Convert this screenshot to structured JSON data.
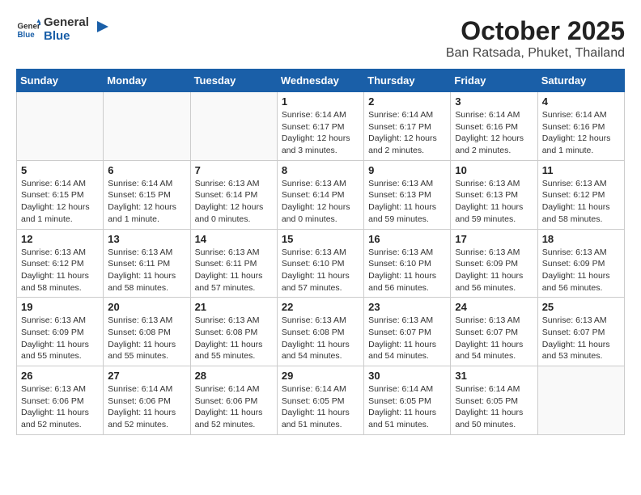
{
  "logo": {
    "text_general": "General",
    "text_blue": "Blue"
  },
  "header": {
    "month": "October 2025",
    "location": "Ban Ratsada, Phuket, Thailand"
  },
  "weekdays": [
    "Sunday",
    "Monday",
    "Tuesday",
    "Wednesday",
    "Thursday",
    "Friday",
    "Saturday"
  ],
  "weeks": [
    [
      {
        "day": "",
        "info": ""
      },
      {
        "day": "",
        "info": ""
      },
      {
        "day": "",
        "info": ""
      },
      {
        "day": "1",
        "info": "Sunrise: 6:14 AM\nSunset: 6:17 PM\nDaylight: 12 hours and 3 minutes."
      },
      {
        "day": "2",
        "info": "Sunrise: 6:14 AM\nSunset: 6:17 PM\nDaylight: 12 hours and 2 minutes."
      },
      {
        "day": "3",
        "info": "Sunrise: 6:14 AM\nSunset: 6:16 PM\nDaylight: 12 hours and 2 minutes."
      },
      {
        "day": "4",
        "info": "Sunrise: 6:14 AM\nSunset: 6:16 PM\nDaylight: 12 hours and 1 minute."
      }
    ],
    [
      {
        "day": "5",
        "info": "Sunrise: 6:14 AM\nSunset: 6:15 PM\nDaylight: 12 hours and 1 minute."
      },
      {
        "day": "6",
        "info": "Sunrise: 6:14 AM\nSunset: 6:15 PM\nDaylight: 12 hours and 1 minute."
      },
      {
        "day": "7",
        "info": "Sunrise: 6:13 AM\nSunset: 6:14 PM\nDaylight: 12 hours and 0 minutes."
      },
      {
        "day": "8",
        "info": "Sunrise: 6:13 AM\nSunset: 6:14 PM\nDaylight: 12 hours and 0 minutes."
      },
      {
        "day": "9",
        "info": "Sunrise: 6:13 AM\nSunset: 6:13 PM\nDaylight: 11 hours and 59 minutes."
      },
      {
        "day": "10",
        "info": "Sunrise: 6:13 AM\nSunset: 6:13 PM\nDaylight: 11 hours and 59 minutes."
      },
      {
        "day": "11",
        "info": "Sunrise: 6:13 AM\nSunset: 6:12 PM\nDaylight: 11 hours and 58 minutes."
      }
    ],
    [
      {
        "day": "12",
        "info": "Sunrise: 6:13 AM\nSunset: 6:12 PM\nDaylight: 11 hours and 58 minutes."
      },
      {
        "day": "13",
        "info": "Sunrise: 6:13 AM\nSunset: 6:11 PM\nDaylight: 11 hours and 58 minutes."
      },
      {
        "day": "14",
        "info": "Sunrise: 6:13 AM\nSunset: 6:11 PM\nDaylight: 11 hours and 57 minutes."
      },
      {
        "day": "15",
        "info": "Sunrise: 6:13 AM\nSunset: 6:10 PM\nDaylight: 11 hours and 57 minutes."
      },
      {
        "day": "16",
        "info": "Sunrise: 6:13 AM\nSunset: 6:10 PM\nDaylight: 11 hours and 56 minutes."
      },
      {
        "day": "17",
        "info": "Sunrise: 6:13 AM\nSunset: 6:09 PM\nDaylight: 11 hours and 56 minutes."
      },
      {
        "day": "18",
        "info": "Sunrise: 6:13 AM\nSunset: 6:09 PM\nDaylight: 11 hours and 56 minutes."
      }
    ],
    [
      {
        "day": "19",
        "info": "Sunrise: 6:13 AM\nSunset: 6:09 PM\nDaylight: 11 hours and 55 minutes."
      },
      {
        "day": "20",
        "info": "Sunrise: 6:13 AM\nSunset: 6:08 PM\nDaylight: 11 hours and 55 minutes."
      },
      {
        "day": "21",
        "info": "Sunrise: 6:13 AM\nSunset: 6:08 PM\nDaylight: 11 hours and 55 minutes."
      },
      {
        "day": "22",
        "info": "Sunrise: 6:13 AM\nSunset: 6:08 PM\nDaylight: 11 hours and 54 minutes."
      },
      {
        "day": "23",
        "info": "Sunrise: 6:13 AM\nSunset: 6:07 PM\nDaylight: 11 hours and 54 minutes."
      },
      {
        "day": "24",
        "info": "Sunrise: 6:13 AM\nSunset: 6:07 PM\nDaylight: 11 hours and 54 minutes."
      },
      {
        "day": "25",
        "info": "Sunrise: 6:13 AM\nSunset: 6:07 PM\nDaylight: 11 hours and 53 minutes."
      }
    ],
    [
      {
        "day": "26",
        "info": "Sunrise: 6:13 AM\nSunset: 6:06 PM\nDaylight: 11 hours and 52 minutes."
      },
      {
        "day": "27",
        "info": "Sunrise: 6:14 AM\nSunset: 6:06 PM\nDaylight: 11 hours and 52 minutes."
      },
      {
        "day": "28",
        "info": "Sunrise: 6:14 AM\nSunset: 6:06 PM\nDaylight: 11 hours and 52 minutes."
      },
      {
        "day": "29",
        "info": "Sunrise: 6:14 AM\nSunset: 6:05 PM\nDaylight: 11 hours and 51 minutes."
      },
      {
        "day": "30",
        "info": "Sunrise: 6:14 AM\nSunset: 6:05 PM\nDaylight: 11 hours and 51 minutes."
      },
      {
        "day": "31",
        "info": "Sunrise: 6:14 AM\nSunset: 6:05 PM\nDaylight: 11 hours and 50 minutes."
      },
      {
        "day": "",
        "info": ""
      }
    ]
  ]
}
